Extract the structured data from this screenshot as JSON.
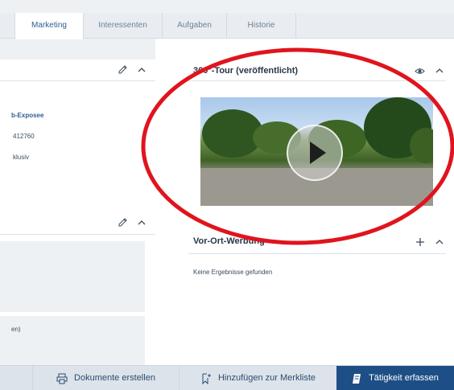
{
  "tabs": [
    {
      "label": "Marketing",
      "active": true
    },
    {
      "label": "Interessenten",
      "active": false
    },
    {
      "label": "Aufgaben",
      "active": false
    },
    {
      "label": "Historie",
      "active": false
    }
  ],
  "left_panel": {
    "link_text": "b-Exposee",
    "id_text": "412760",
    "flag_text": "klusiv",
    "bottom_text": "en)"
  },
  "tour": {
    "title": "360°-Tour (veröffentlicht)"
  },
  "vorort": {
    "title": "Vor-Ort-Werbung",
    "empty_text": "Keine Ergebnisse gefunden"
  },
  "buttons": {
    "docs": "Dokumente erstellen",
    "merkliste": "Hinzufügen zur Merkliste",
    "taetigkeit": "Tätigkeit erfassen"
  },
  "colors": {
    "annotation_red": "#e0141d",
    "primary": "#1d4f86"
  },
  "icons": [
    "pencil-icon",
    "chevron-up-icon",
    "eye-icon",
    "plus-icon",
    "print-icon",
    "bookmark-add-icon",
    "notebook-icon",
    "play-icon"
  ]
}
